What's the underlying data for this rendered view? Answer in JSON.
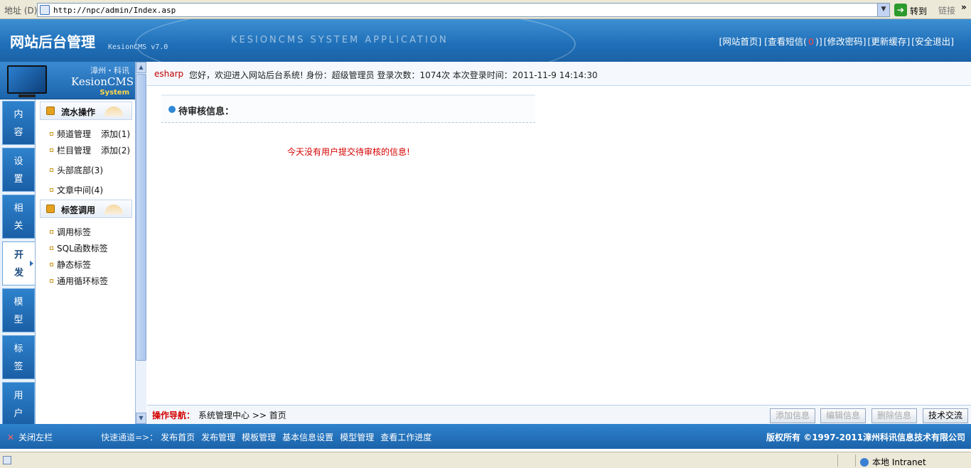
{
  "browser": {
    "address_label": "地址 (D)",
    "url": "http://npc/admin/Index.asp",
    "go_label": "转到",
    "links_label": "链接",
    "more_label": "»"
  },
  "header": {
    "title": "网站后台管理",
    "version": "KesionCMS v7.0",
    "banner": "KESIONCMS SYSTEM APPLICATION",
    "nav": {
      "home": "[网站首页]",
      "messages_pre": "[查看短信(",
      "messages_count": "0",
      "messages_post": ")]",
      "password": "[修改密码]",
      "cache": "[更新缓存]",
      "logout": "[安全退出]"
    }
  },
  "logo": {
    "line1": "漳州・科讯",
    "line2": "KesionCMS",
    "line3": "System"
  },
  "tabs": [
    {
      "label_top": "内",
      "label_bottom": "容"
    },
    {
      "label_top": "设",
      "label_bottom": "置"
    },
    {
      "label_top": "相",
      "label_bottom": "关"
    },
    {
      "label_top": "开",
      "label_bottom": "发"
    },
    {
      "label_top": "模",
      "label_bottom": "型"
    },
    {
      "label_top": "标",
      "label_bottom": "签"
    },
    {
      "label_top": "用",
      "label_bottom": "户"
    }
  ],
  "menu": {
    "group1": {
      "title": "流水操作",
      "items": [
        {
          "label": "频道管理",
          "add": "添加(1)"
        },
        {
          "label": "栏目管理",
          "add": "添加(2)"
        },
        {
          "label": "头部底部(3)"
        },
        {
          "label": "文章中间(4)"
        }
      ]
    },
    "group2": {
      "title": "标签调用",
      "items": [
        {
          "label": "调用标签"
        },
        {
          "label": "SQL函数标签"
        },
        {
          "label": "静态标签"
        },
        {
          "label": "通用循环标签"
        }
      ]
    }
  },
  "welcome": {
    "user": "esharp",
    "message": "您好，欢迎进入网站后台系统! 身份：超级管理员 登录次数：1074次 本次登录时间：2011-11-9 14:14:30"
  },
  "main": {
    "pending_title": "待审核信息：",
    "notice": "今天没有用户提交待审核的信息!"
  },
  "opbar": {
    "label": "操作导航：",
    "path": "系统管理中心 >> 首页",
    "buttons": [
      "添加信息",
      "编辑信息",
      "删除信息",
      "技术交流"
    ]
  },
  "footer": {
    "close_label": "关闭左栏",
    "quick_label": "快速通道=>：",
    "quick_links": [
      "发布首页",
      "发布管理",
      "模板管理",
      "基本信息设置",
      "模型管理",
      "查看工作进度"
    ],
    "copyright": "版权所有 ©1997-2011漳州科讯信息技术有限公司"
  },
  "status": {
    "zone": "本地 Intranet"
  }
}
